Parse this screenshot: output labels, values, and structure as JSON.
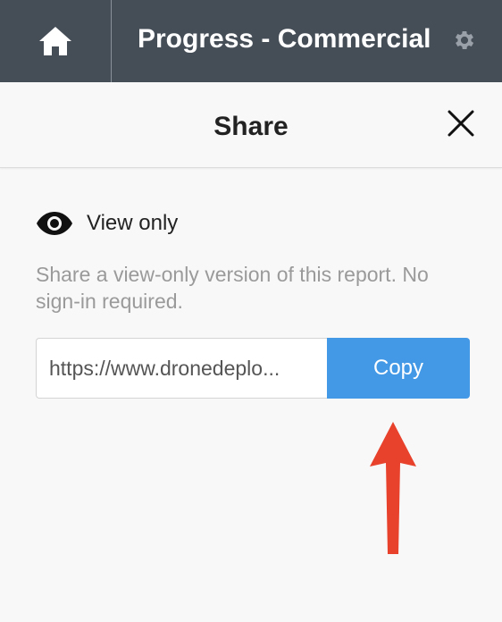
{
  "header": {
    "title": "Progress - Commercial",
    "home_icon": "home-icon",
    "settings_icon": "gear-icon",
    "background": "#454d57"
  },
  "panel": {
    "title": "Share",
    "close_icon": "close-icon"
  },
  "share": {
    "mode_icon": "eye-icon",
    "mode_label": "View only",
    "description": "Share a view-only version of this report. No sign-in required.",
    "link_value": "https://www.dronedeplo...",
    "copy_label": "Copy",
    "accent_color": "#4399e6"
  },
  "annotation": {
    "arrow_icon": "red-arrow-icon",
    "arrow_color": "#e8412c"
  }
}
